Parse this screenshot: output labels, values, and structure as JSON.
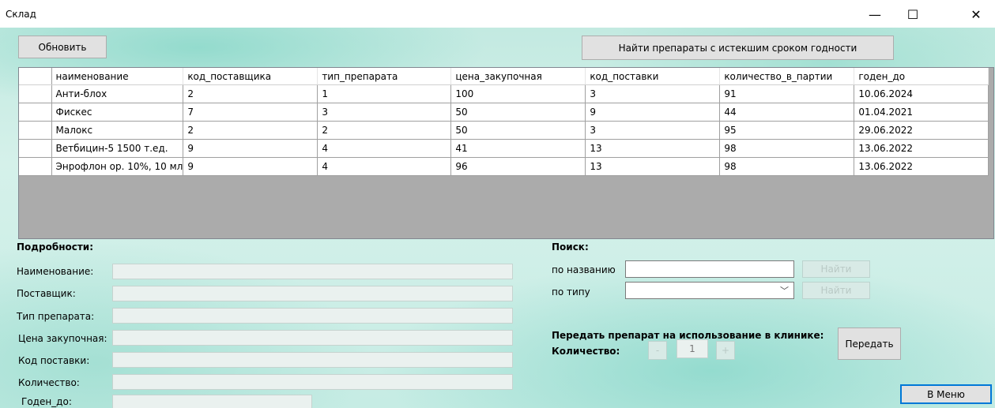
{
  "window": {
    "title": "Склад",
    "minimize_glyph": "—",
    "maximize_glyph": "☐",
    "close_glyph": "✕"
  },
  "toolbar": {
    "refresh_label": "Обновить",
    "expired_label": "Найти препараты с истекшим сроком годности"
  },
  "table": {
    "columns": [
      "наименование",
      "код_поставщика",
      "тип_препарата",
      "цена_закупочная",
      "код_поставки",
      "количество_в_партии",
      "годен_до"
    ],
    "rows": [
      [
        "Анти-блох",
        "2",
        "1",
        "100",
        "3",
        "91",
        "10.06.2024"
      ],
      [
        "Фискес",
        "7",
        "3",
        "50",
        "9",
        "44",
        "01.04.2021"
      ],
      [
        "Малокс",
        "2",
        "2",
        "50",
        "3",
        "95",
        "29.06.2022"
      ],
      [
        "Ветбицин-5 1500 т.ед.",
        "9",
        "4",
        "41",
        "13",
        "98",
        "13.06.2022"
      ],
      [
        "Энрофлон ор. 10%, 10 мл",
        "9",
        "4",
        "96",
        "13",
        "98",
        "13.06.2022"
      ]
    ]
  },
  "details": {
    "heading": "Подробности:",
    "name_label": "Наименование:",
    "supplier_label": "Поставщик:",
    "type_label": "Тип препарата:",
    "price_label": "Цена закупочная:",
    "delivery_label": "Код поставки:",
    "quantity_label": "Количество:",
    "expiry_label": "Годен_до:"
  },
  "search": {
    "heading": "Поиск:",
    "by_name_label": "по названию",
    "by_type_label": "по типу",
    "find_label": "Найти",
    "find_type_label": "Найти",
    "name_value": "",
    "type_value": ""
  },
  "transfer": {
    "heading": "Передать препарат на использование в клинике:",
    "quantity_label": "Количество:",
    "minus_label": "-",
    "quantity_value": "1",
    "plus_label": "+",
    "transfer_label": "Передать"
  },
  "menu_label": "В Меню"
}
